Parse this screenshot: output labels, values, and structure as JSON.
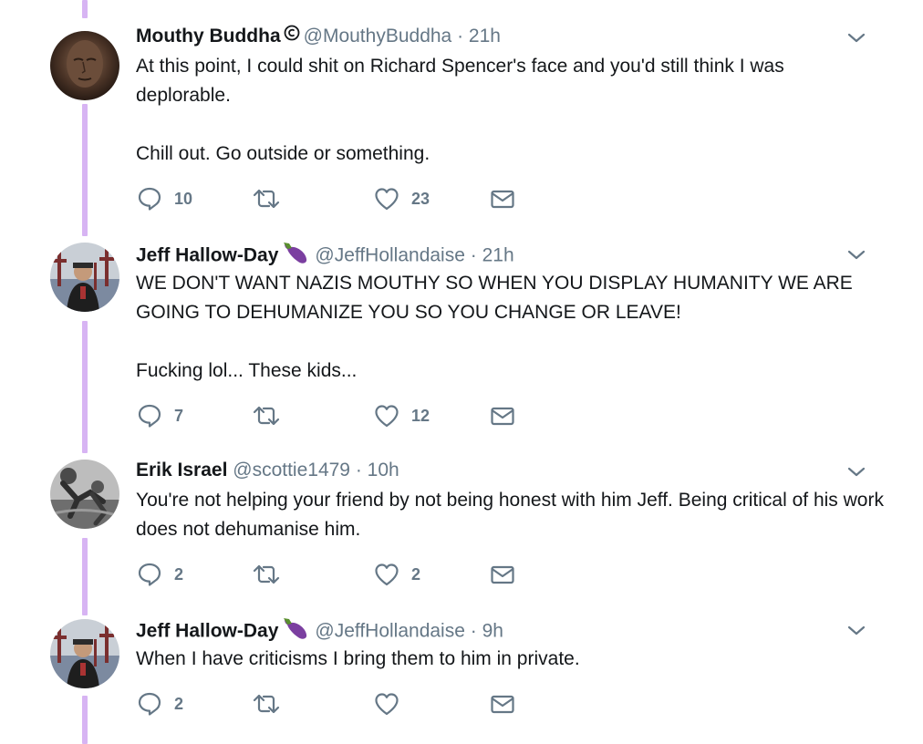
{
  "thread": {
    "tweets": [
      {
        "name": "Mouthy Buddha",
        "verified_mark": "copyright-icon",
        "handle": "@MouthyBuddha",
        "separator": "·",
        "time": "21h",
        "text": "At this point, I could shit on Richard Spencer's face and you'd still think I was deplorable.\n\nChill out. Go outside or something.",
        "reply_count": "10",
        "retweet_count": "",
        "like_count": "23"
      },
      {
        "name": "Jeff Hallow-Day",
        "name_emoji": "eggplant-icon",
        "handle": "@JeffHollandaise",
        "separator": "·",
        "time": "21h",
        "text": "WE DON'T WANT NAZIS MOUTHY SO WHEN YOU DISPLAY HUMANITY WE ARE GOING TO DEHUMANIZE YOU SO YOU CHANGE OR LEAVE!\n\nFucking lol... These kids...",
        "reply_count": "7",
        "retweet_count": "",
        "like_count": "12"
      },
      {
        "name": "Erik Israel",
        "handle": "@scottie1479",
        "separator": "·",
        "time": "10h",
        "text": "You're not helping your friend by not being honest with him Jeff. Being critical of his work does not dehumanise him.",
        "reply_count": "2",
        "retweet_count": "",
        "like_count": "2"
      },
      {
        "name": "Jeff Hallow-Day",
        "name_emoji": "eggplant-icon",
        "handle": "@JeffHollandaise",
        "separator": "·",
        "time": "9h",
        "text": "When I have criticisms I bring them to him in private.",
        "reply_count": "2",
        "retweet_count": "",
        "like_count": ""
      }
    ]
  },
  "colors": {
    "thread_line": "#d7b4f3",
    "text": "#14171a",
    "secondary": "#657786",
    "icon": "#657786"
  }
}
